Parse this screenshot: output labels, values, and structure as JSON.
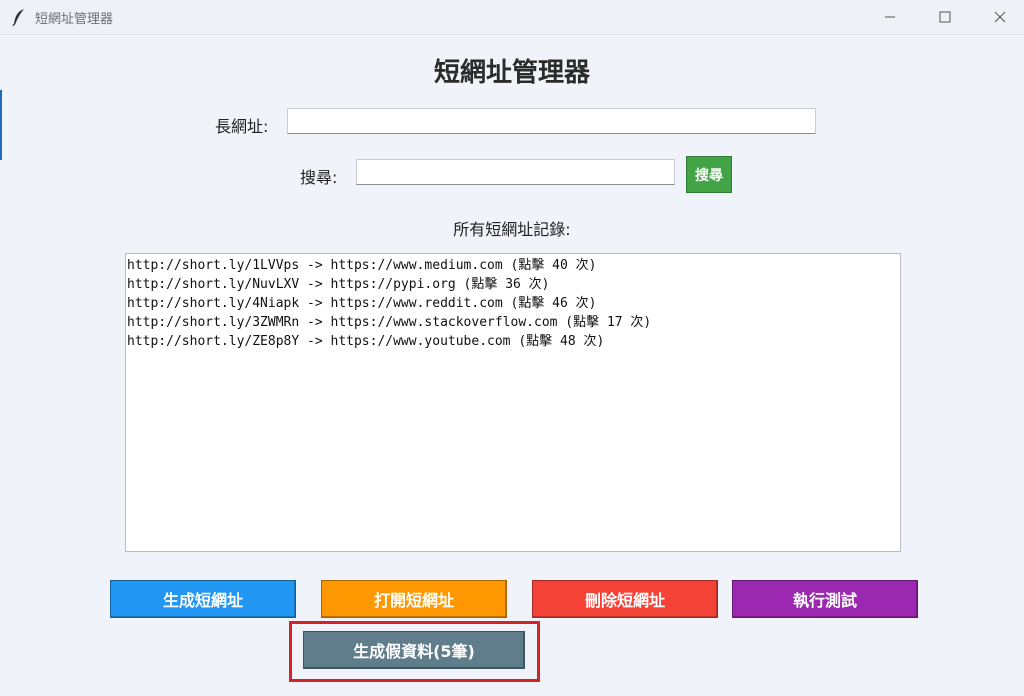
{
  "window": {
    "title": "短網址管理器"
  },
  "main": {
    "heading": "短網址管理器",
    "long_url_label": "長網址:",
    "long_url_value": "",
    "search_label": "搜尋:",
    "search_value": "",
    "search_button": "搜尋",
    "records_label": "所有短網址記錄:",
    "records": [
      "http://short.ly/1LVVps -> https://www.medium.com (點擊 40 次)",
      "http://short.ly/NuvLXV -> https://pypi.org (點擊 36 次)",
      "http://short.ly/4Niapk -> https://www.reddit.com (點擊 46 次)",
      "http://short.ly/3ZWMRn -> https://www.stackoverflow.com (點擊 17 次)",
      "http://short.ly/ZE8p8Y -> https://www.youtube.com (點擊 48 次)"
    ]
  },
  "actions": {
    "generate": "生成短網址",
    "open": "打開短網址",
    "delete": "刪除短網址",
    "test": "執行測試",
    "fake_data": "生成假資料(5筆)"
  },
  "colors": {
    "generate": "#2196f3",
    "open": "#ff9800",
    "delete": "#f44336",
    "test": "#9c27b0",
    "fake_data": "#607d8b",
    "search": "#43a447",
    "highlight_box": "#d0232a"
  },
  "icons": {
    "app": "feather-icon",
    "minimize": "minimize-icon",
    "maximize": "maximize-icon",
    "close": "close-icon"
  }
}
